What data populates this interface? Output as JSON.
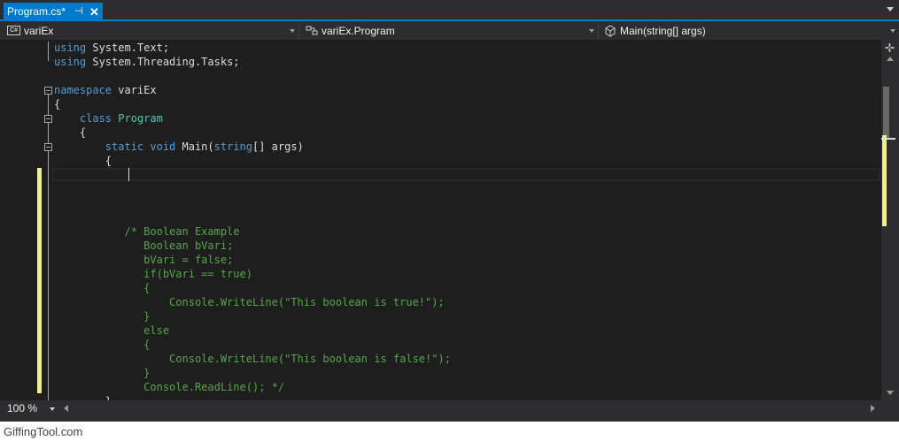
{
  "tab": {
    "title": "Program.cs*",
    "pin_glyph": "⊣",
    "close_glyph": "✕"
  },
  "navbar": {
    "project": "variEx",
    "project_icon": "csharp-file-icon",
    "class": "variEx.Program",
    "class_icon": "class-icon",
    "member": "Main(string[] args)",
    "member_icon": "method-icon"
  },
  "code": {
    "lines": [
      [
        {
          "t": "using ",
          "c": "kw"
        },
        {
          "t": "System.Text;",
          "c": ""
        }
      ],
      [
        {
          "t": "using ",
          "c": "kw"
        },
        {
          "t": "System.Threading.Tasks;",
          "c": ""
        }
      ],
      [],
      [
        {
          "t": "namespace ",
          "c": "kw"
        },
        {
          "t": "variEx",
          "c": ""
        }
      ],
      [
        {
          "t": "{",
          "c": ""
        }
      ],
      [
        {
          "t": "    ",
          "c": ""
        },
        {
          "t": "class ",
          "c": "kw"
        },
        {
          "t": "Program",
          "c": "type"
        }
      ],
      [
        {
          "t": "    {",
          "c": ""
        }
      ],
      [
        {
          "t": "        ",
          "c": ""
        },
        {
          "t": "static ",
          "c": "kw"
        },
        {
          "t": "void ",
          "c": "kw"
        },
        {
          "t": "Main(",
          "c": ""
        },
        {
          "t": "string",
          "c": "kw"
        },
        {
          "t": "[] args)",
          "c": ""
        }
      ],
      [
        {
          "t": "        {",
          "c": ""
        }
      ],
      [],
      [],
      [],
      [],
      [
        {
          "t": "           /* Boolean Example",
          "c": "cm"
        }
      ],
      [
        {
          "t": "              Boolean bVari;",
          "c": "cm"
        }
      ],
      [
        {
          "t": "              bVari = false;",
          "c": "cm"
        }
      ],
      [
        {
          "t": "              if(bVari == true)",
          "c": "cm"
        }
      ],
      [
        {
          "t": "              {",
          "c": "cm"
        }
      ],
      [
        {
          "t": "                  Console.WriteLine(\"This boolean is true!\");",
          "c": "cm"
        }
      ],
      [
        {
          "t": "              }",
          "c": "cm"
        }
      ],
      [
        {
          "t": "              else",
          "c": "cm"
        }
      ],
      [
        {
          "t": "              {",
          "c": "cm"
        }
      ],
      [
        {
          "t": "                  Console.WriteLine(\"This boolean is false!\");",
          "c": "cm"
        }
      ],
      [
        {
          "t": "              }",
          "c": "cm"
        }
      ],
      [
        {
          "t": "              Console.ReadLine(); */",
          "c": "cm"
        }
      ],
      [
        {
          "t": "        }",
          "c": ""
        }
      ]
    ]
  },
  "zoom": {
    "value": "100 %"
  },
  "watermark": "GiffingTool.com",
  "colors": {
    "accent": "#007acc",
    "editor_bg": "#1e1e1e",
    "keyword": "#569cd6",
    "type": "#4ec9b0",
    "comment": "#57a64a",
    "change_marker": "#efef91"
  }
}
